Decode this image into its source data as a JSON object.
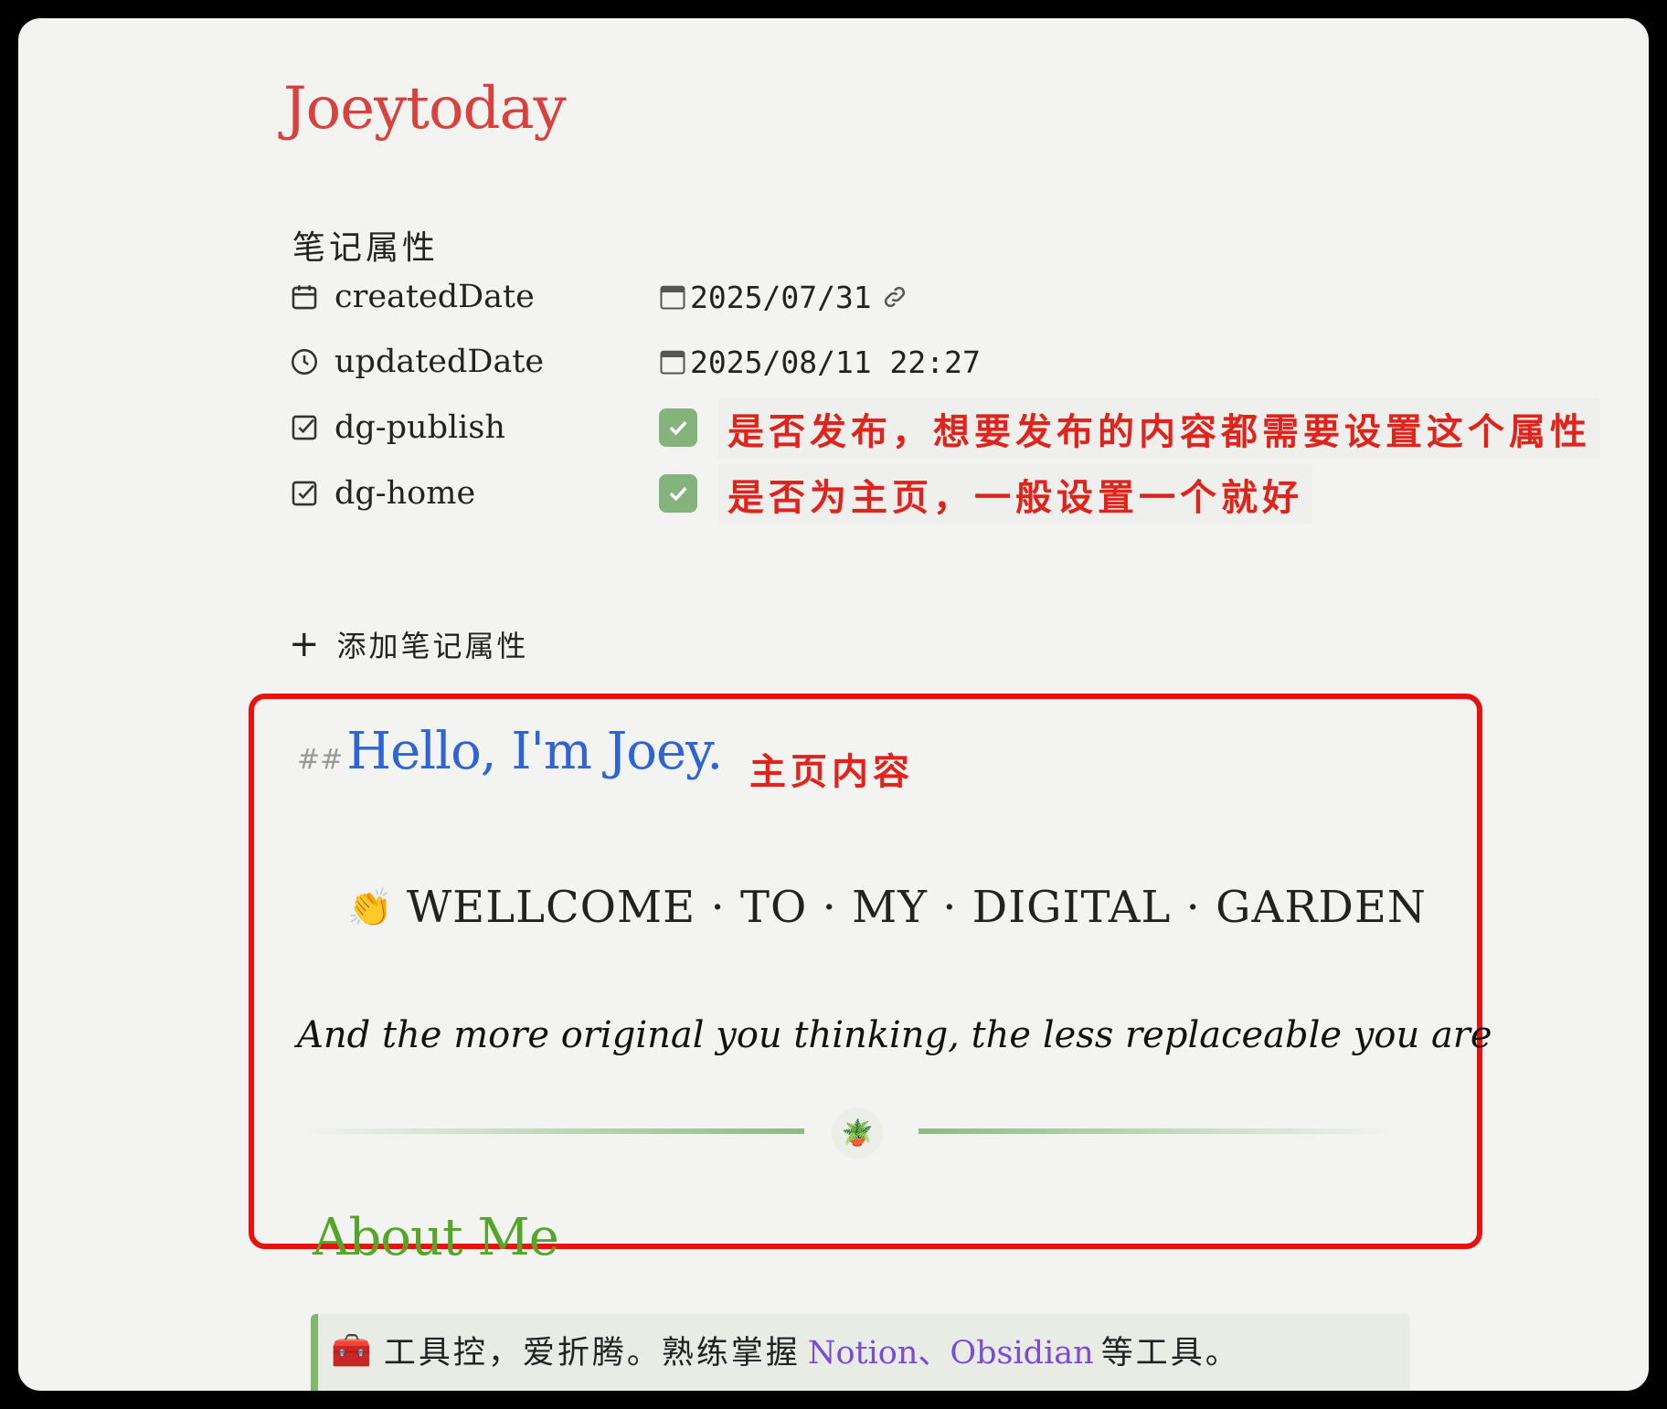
{
  "page": {
    "title": "Joeytoday"
  },
  "properties": {
    "heading": "笔记属性",
    "rows": [
      {
        "icon": "calendar-icon",
        "key": "createdDate",
        "value": "2025/07/31"
      },
      {
        "icon": "clock-icon",
        "key": "updatedDate",
        "value": "2025/08/11 22:27"
      },
      {
        "icon": "checkbox-icon",
        "key": "dg-publish",
        "checked": true,
        "annotation": "是否发布，想要发布的内容都需要设置这个属性"
      },
      {
        "icon": "checkbox-icon",
        "key": "dg-home",
        "checked": true,
        "annotation": "是否为主页，一般设置一个就好"
      }
    ],
    "add_label": "添加笔记属性"
  },
  "content": {
    "heading_marker": "##",
    "heading": "Hello, I'm Joey.",
    "annotation": "主页内容",
    "welcome_emoji": "👏",
    "welcome": "WELLCOME · TO · MY · DIGITAL · GARDEN",
    "quote": "And the more original you thinking, the less replaceable you are",
    "divider_emoji": "🪴",
    "about_heading": "About Me",
    "callout": {
      "emoji": "🧰",
      "text_before": "工具控，爱折腾。熟练掌握",
      "tools": "Notion、Obsidian",
      "text_after": "等工具。"
    }
  },
  "colors": {
    "title": "#d9413d",
    "annotation": "#e0241b",
    "heading": "#2f64d6",
    "about": "#55a52a",
    "checkbox": "#85b37c",
    "tools_link": "#7a4ad9",
    "frame": "#e8130f"
  }
}
